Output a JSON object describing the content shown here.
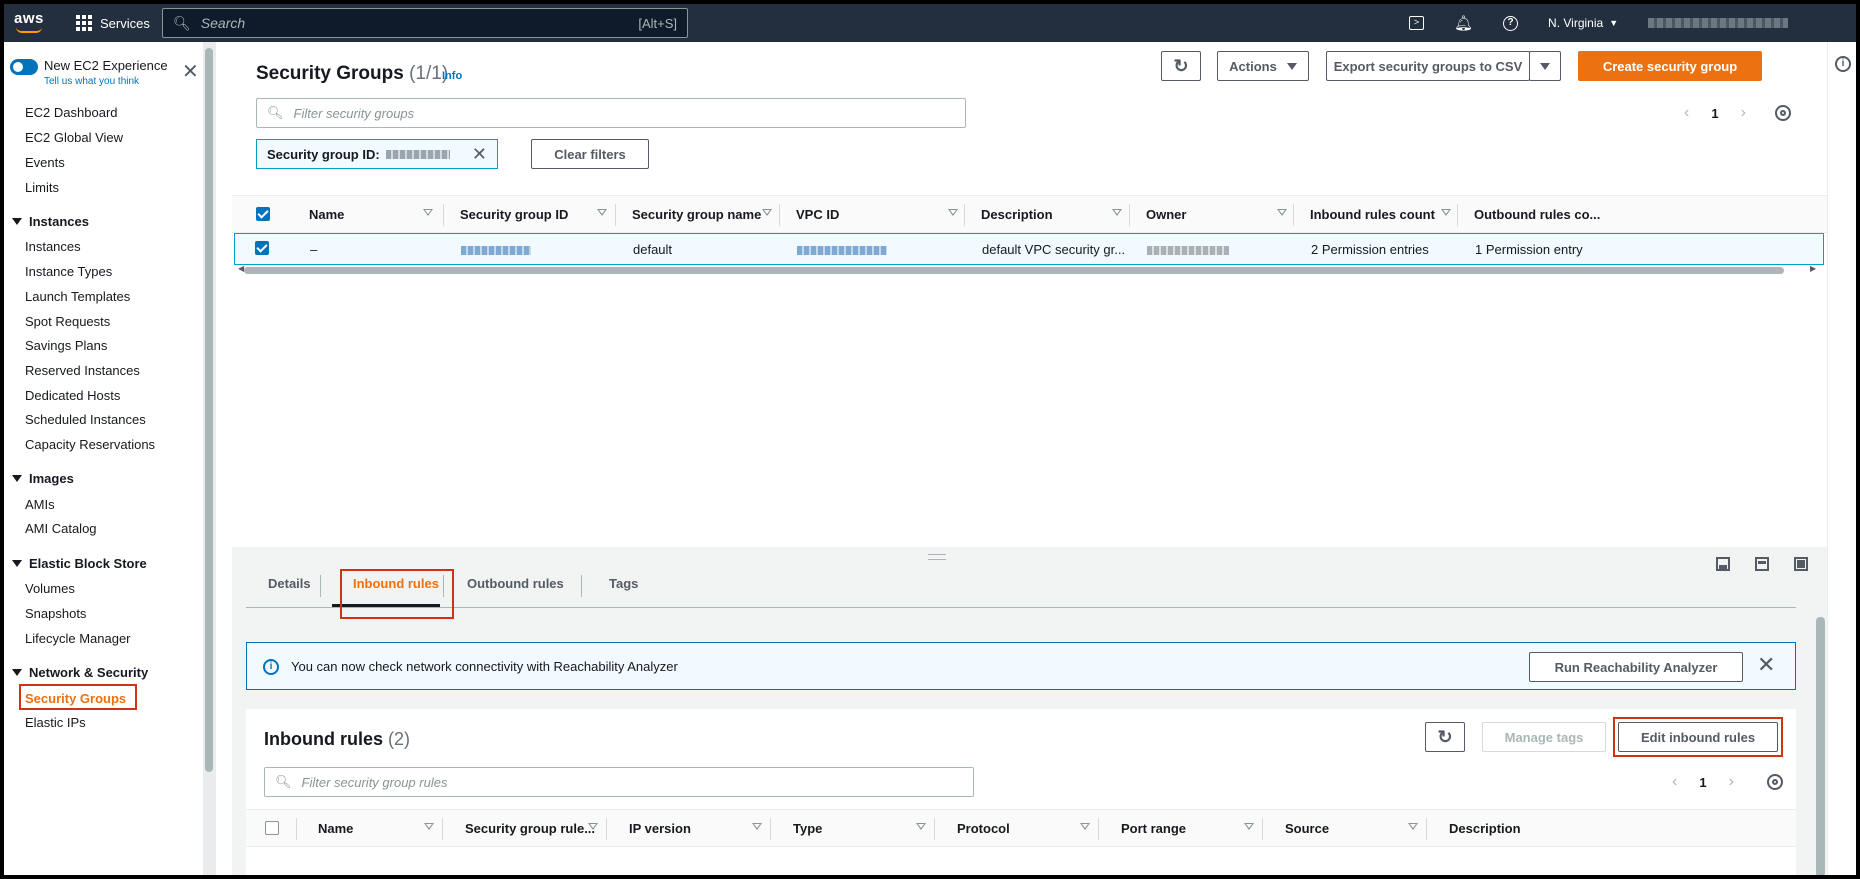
{
  "topnav": {
    "logo": "aws",
    "services_label": "Services",
    "search_placeholder": "Search",
    "search_shortcut": "[Alt+S]",
    "region": "N. Virginia"
  },
  "sidebar": {
    "new_experience_label": "New EC2 Experience",
    "feedback_link": "Tell us what you think",
    "top_items": [
      "EC2 Dashboard",
      "EC2 Global View",
      "Events",
      "Limits"
    ],
    "sections": [
      {
        "title": "Instances",
        "items": [
          "Instances",
          "Instance Types",
          "Launch Templates",
          "Spot Requests",
          "Savings Plans",
          "Reserved Instances",
          "Dedicated Hosts",
          "Scheduled Instances",
          "Capacity Reservations"
        ]
      },
      {
        "title": "Images",
        "items": [
          "AMIs",
          "AMI Catalog"
        ]
      },
      {
        "title": "Elastic Block Store",
        "items": [
          "Volumes",
          "Snapshots",
          "Lifecycle Manager"
        ]
      },
      {
        "title": "Network & Security",
        "items": [
          "Security Groups",
          "Elastic IPs"
        ]
      }
    ],
    "active_item": "Security Groups"
  },
  "security_groups": {
    "title": "Security Groups",
    "count": "(1/1)",
    "info_label": "Info",
    "actions_label": "Actions",
    "export_label": "Export security groups to CSV",
    "create_label": "Create security group",
    "filter_placeholder": "Filter security groups",
    "page_number": "1",
    "token_label": "Security group ID:",
    "clear_filters_label": "Clear filters",
    "columns": [
      "Name",
      "Security group ID",
      "Security group name",
      "VPC ID",
      "Description",
      "Owner",
      "Inbound rules count",
      "Outbound rules co..."
    ],
    "row": {
      "name": "–",
      "security_group_name": "default",
      "description": "default VPC security gr...",
      "inbound_rules_count": "2 Permission entries",
      "outbound_rules_count": "1 Permission entry"
    }
  },
  "details_tabs": [
    "Details",
    "Inbound rules",
    "Outbound rules",
    "Tags"
  ],
  "active_tab": "Inbound rules",
  "flash": {
    "message": "You can now check network connectivity with Reachability Analyzer",
    "button_label": "Run Reachability Analyzer"
  },
  "inbound_rules": {
    "title": "Inbound rules",
    "count": "(2)",
    "manage_tags_label": "Manage tags",
    "edit_label": "Edit inbound rules",
    "filter_placeholder": "Filter security group rules",
    "page_number": "1",
    "columns": [
      "Name",
      "Security group rule...",
      "IP version",
      "Type",
      "Protocol",
      "Port range",
      "Source",
      "Description"
    ]
  },
  "colors": {
    "brand_orange": "#ec7211",
    "nav_background": "#232f3e",
    "link_blue": "#0073bb",
    "highlight_red": "#d13212"
  }
}
